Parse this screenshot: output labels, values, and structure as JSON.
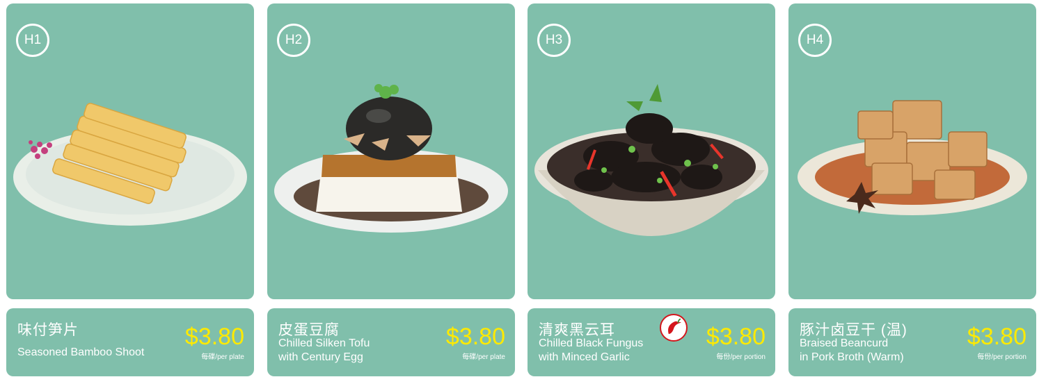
{
  "menu": {
    "items": [
      {
        "code": "H1",
        "name_zh": "味付笋片",
        "name_en_1": "Seasoned Bamboo Shoot",
        "name_en_2": "",
        "price": "$3.80",
        "unit": "每碟/per plate",
        "spicy": false
      },
      {
        "code": "H2",
        "name_zh": "皮蛋豆腐",
        "name_en_1": "Chilled Silken Tofu",
        "name_en_2": "with Century Egg",
        "price": "$3.80",
        "unit": "每碟/per plate",
        "spicy": false
      },
      {
        "code": "H3",
        "name_zh": "清爽黑云耳",
        "name_en_1": "Chilled Black Fungus",
        "name_en_2": "with Minced Garlic",
        "price": "$3.80",
        "unit": "每份/per portion",
        "spicy": true
      },
      {
        "code": "H4",
        "name_zh": "豚汁卤豆干 (温)",
        "name_en_1": "Braised Beancurd",
        "name_en_2": "in Pork Broth (Warm)",
        "price": "$3.80",
        "unit": "每份/per portion",
        "spicy": false
      }
    ]
  },
  "colors": {
    "card_background": "#80bfab",
    "price": "#ffea00",
    "chili_red": "#d4161c"
  },
  "icons": [
    "bamboo-shoot-image",
    "tofu-century-egg-image",
    "black-fungus-image",
    "braised-beancurd-image",
    "chili-icon"
  ]
}
